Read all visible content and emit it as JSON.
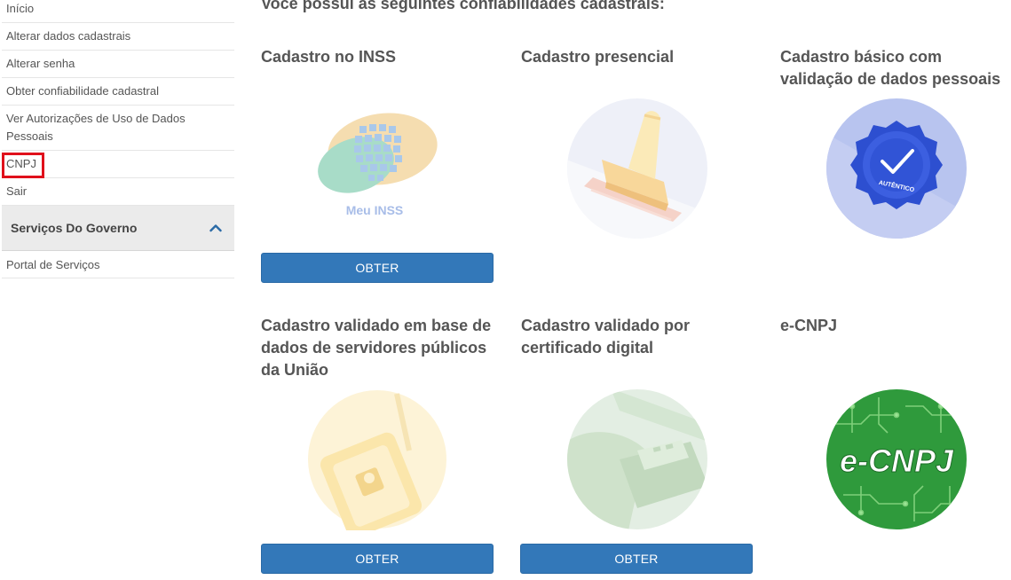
{
  "sidebar": {
    "items": [
      {
        "label": "Início"
      },
      {
        "label": "Alterar dados cadastrais"
      },
      {
        "label": "Alterar senha"
      },
      {
        "label": "Obter confiabilidade cadastral"
      },
      {
        "label": "Ver Autorizações de Uso de Dados Pessoais"
      },
      {
        "label": "CNPJ"
      },
      {
        "label": "Sair"
      }
    ],
    "section": {
      "title": "Serviços Do Governo",
      "icon": "chevron-up-icon"
    },
    "section_items": [
      {
        "label": "Portal de Serviços"
      }
    ]
  },
  "main": {
    "heading": "Você possui as seguintes confiabilidades cadastrais:",
    "cards": [
      {
        "title": "Cadastro no INSS",
        "image_text": "Meu INSS",
        "button": "OBTER"
      },
      {
        "title": "Cadastro presencial"
      },
      {
        "title": "Cadastro básico com validação de dados pessoais",
        "image_text": "AUTÊNTICO"
      },
      {
        "title": "Cadastro validado em base de dados de servidores públicos da União",
        "button": "OBTER"
      },
      {
        "title": "Cadastro validado por certificado digital",
        "button": "OBTER"
      },
      {
        "title": "e-CNPJ",
        "image_text": "e-CNPJ"
      }
    ]
  },
  "colors": {
    "button": "#3378b9",
    "highlight": "#e0101b",
    "ecnpj_green": "#2f9a3c"
  }
}
